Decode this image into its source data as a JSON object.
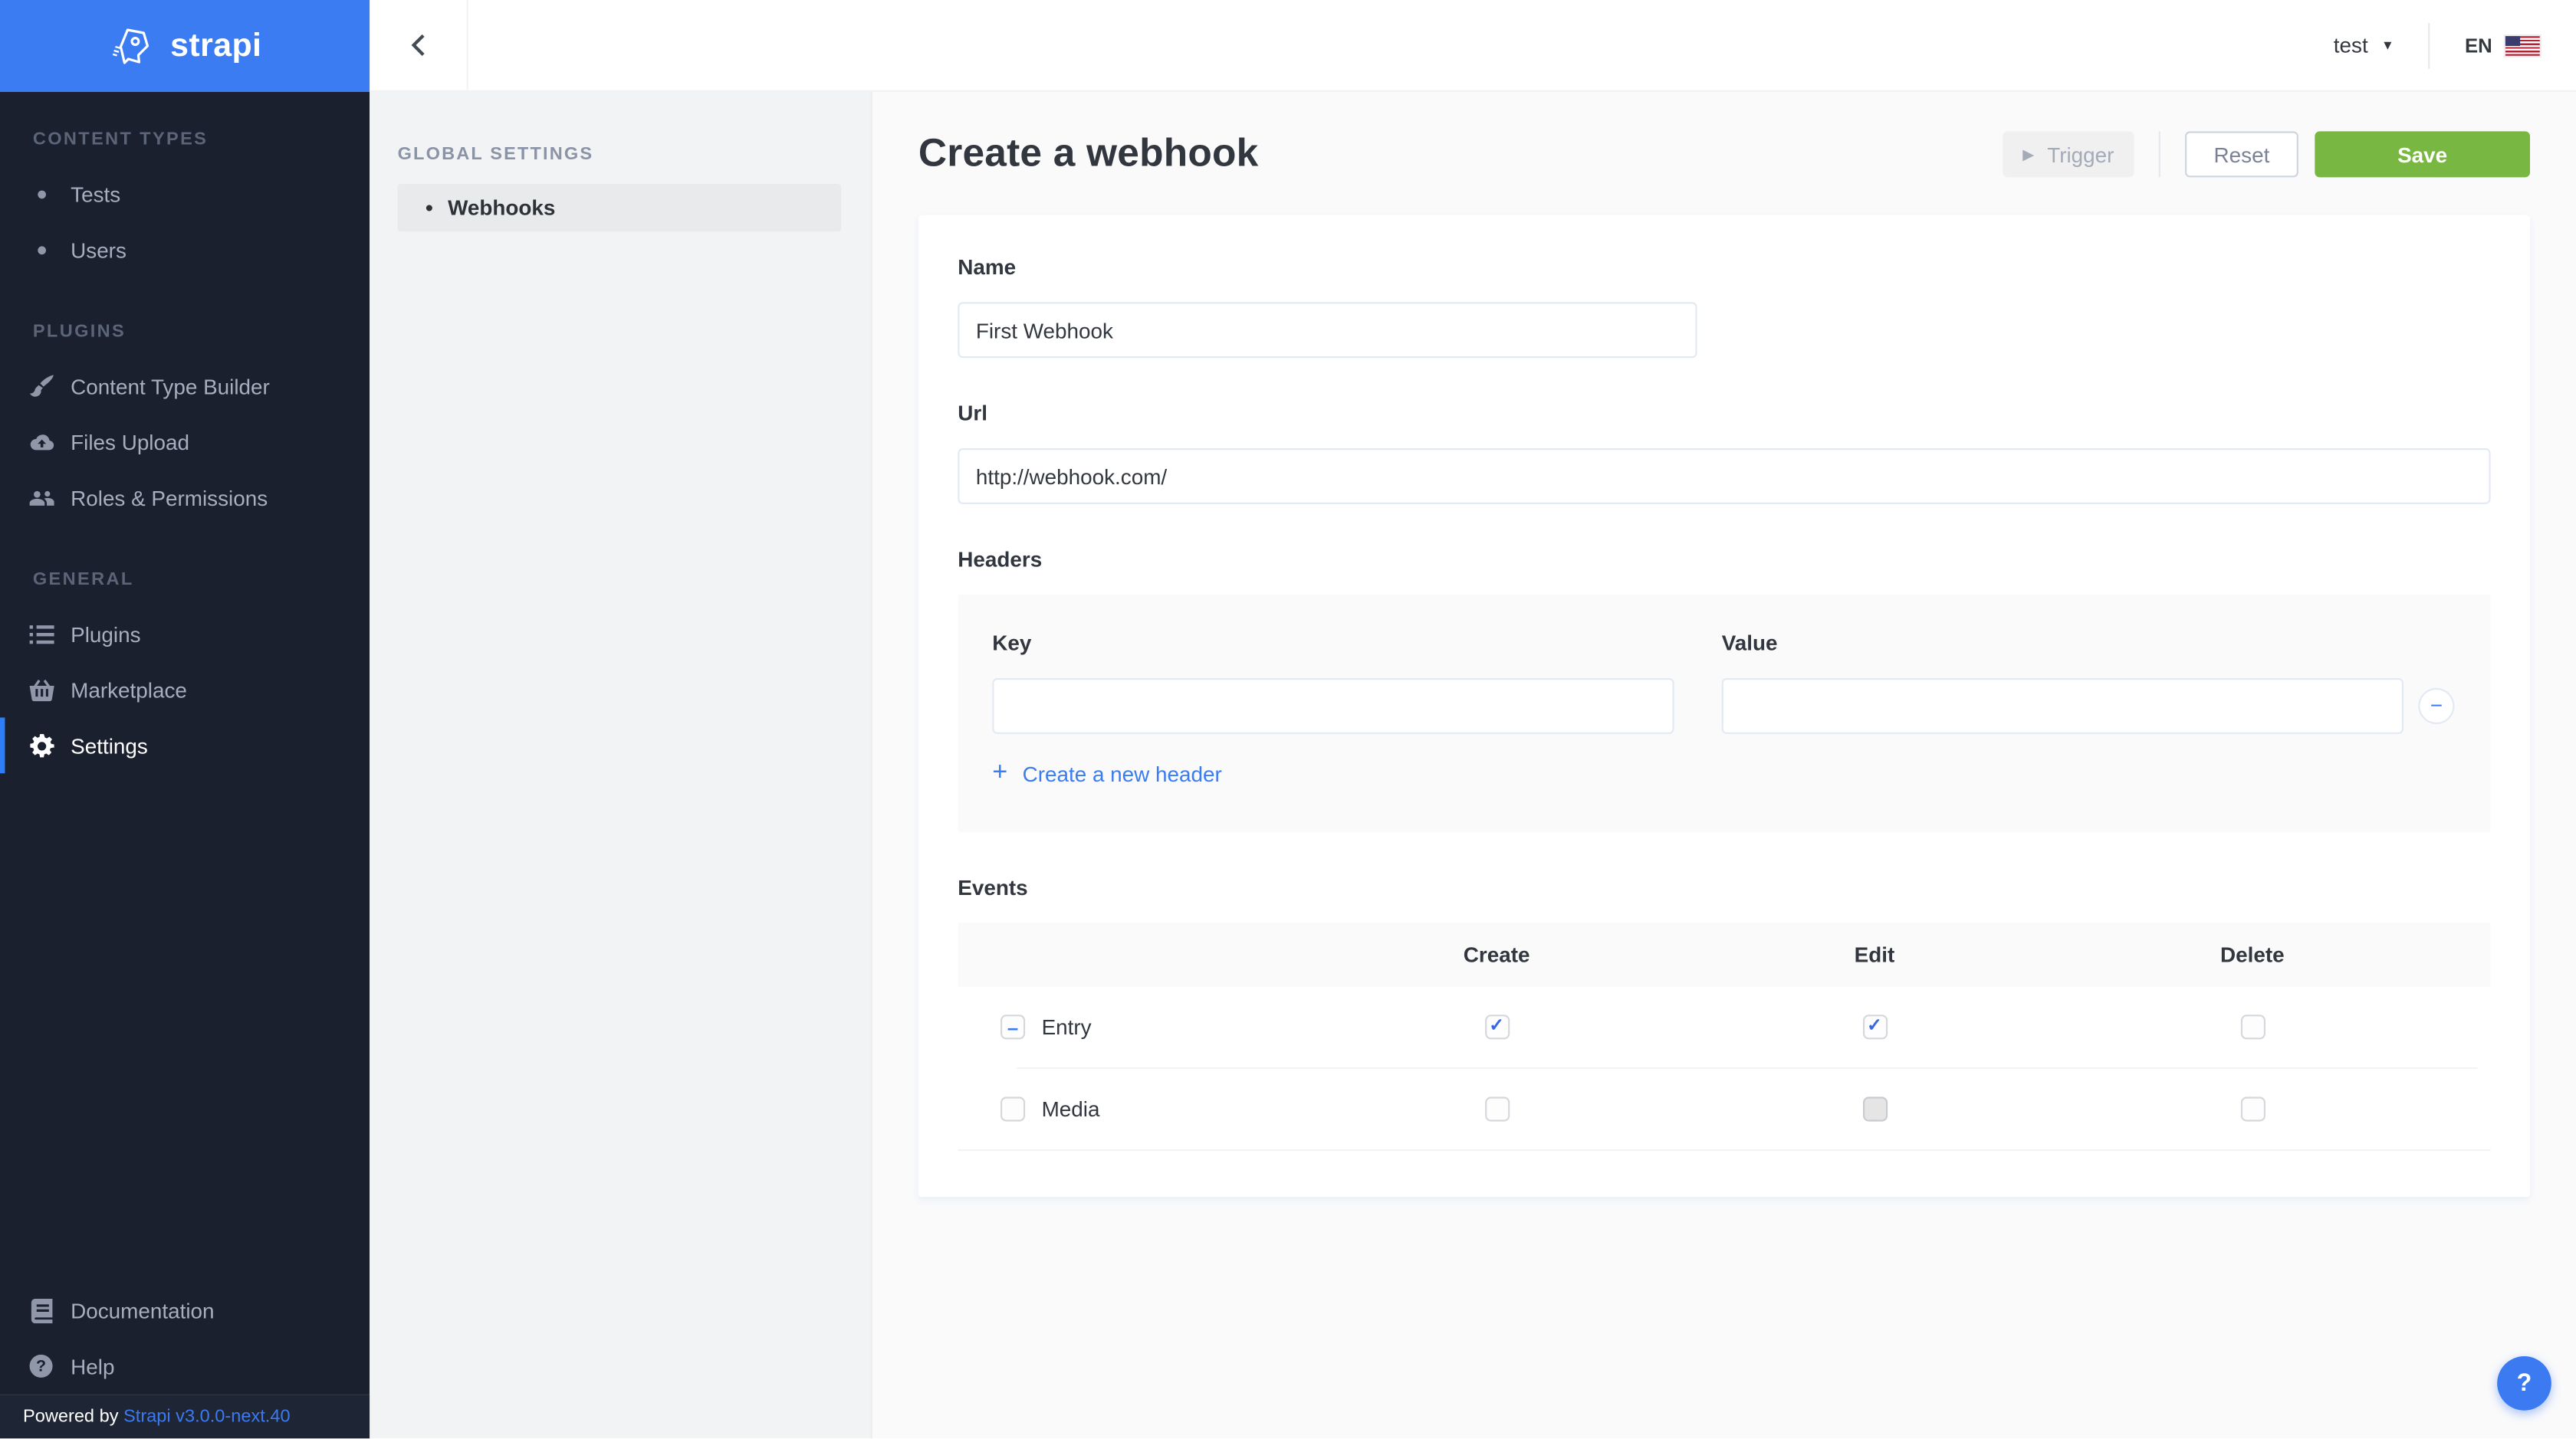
{
  "topbar": {
    "back_icon": "chevron-left",
    "user_label": "test",
    "locale_label": "EN",
    "locale_flag": "us-flag"
  },
  "sidebar": {
    "logo_text": "strapi",
    "sections": [
      {
        "label": "CONTENT TYPES",
        "items": [
          {
            "label": "Tests",
            "icon": "dot"
          },
          {
            "label": "Users",
            "icon": "dot"
          }
        ]
      },
      {
        "label": "PLUGINS",
        "items": [
          {
            "label": "Content Type Builder",
            "icon": "paintbrush"
          },
          {
            "label": "Files Upload",
            "icon": "cloud-upload"
          },
          {
            "label": "Roles & Permissions",
            "icon": "users"
          }
        ]
      },
      {
        "label": "GENERAL",
        "items": [
          {
            "label": "Plugins",
            "icon": "list"
          },
          {
            "label": "Marketplace",
            "icon": "basket"
          },
          {
            "label": "Settings",
            "icon": "gear",
            "active": true
          }
        ]
      }
    ],
    "footer_items": [
      {
        "label": "Documentation",
        "icon": "book"
      },
      {
        "label": "Help",
        "icon": "question-circle"
      }
    ],
    "powered_by_prefix": "Powered by ",
    "powered_by_link": "Strapi v3.0.0-next.40"
  },
  "subnav": {
    "header": "GLOBAL SETTINGS",
    "items": [
      {
        "label": "Webhooks",
        "active": true
      }
    ]
  },
  "page": {
    "title": "Create a webhook",
    "actions": {
      "trigger": "Trigger",
      "reset": "Reset",
      "save": "Save"
    },
    "form": {
      "name": {
        "label": "Name",
        "value": "First Webhook"
      },
      "url": {
        "label": "Url",
        "value": "http://webhook.com/"
      },
      "headers": {
        "label": "Headers",
        "key_label": "Key",
        "key_value": "",
        "value_label": "Value",
        "value_value": "",
        "add_label": "Create a new header"
      },
      "events": {
        "label": "Events",
        "columns": [
          "Create",
          "Edit",
          "Delete"
        ],
        "rows": [
          {
            "name": "Entry",
            "name_checkbox": "indeterminate",
            "cells": [
              "checked",
              "checked",
              "unchecked"
            ]
          },
          {
            "name": "Media",
            "name_checkbox": "unchecked",
            "cells": [
              "unchecked",
              "disabled",
              "unchecked"
            ]
          }
        ]
      }
    }
  },
  "colors": {
    "accent_blue": "#3b7af0",
    "logo_blue": "#3b7cf2",
    "save_green": "#77b742",
    "sidebar_bg": "#1a202e",
    "content_bg": "#fafafb"
  }
}
